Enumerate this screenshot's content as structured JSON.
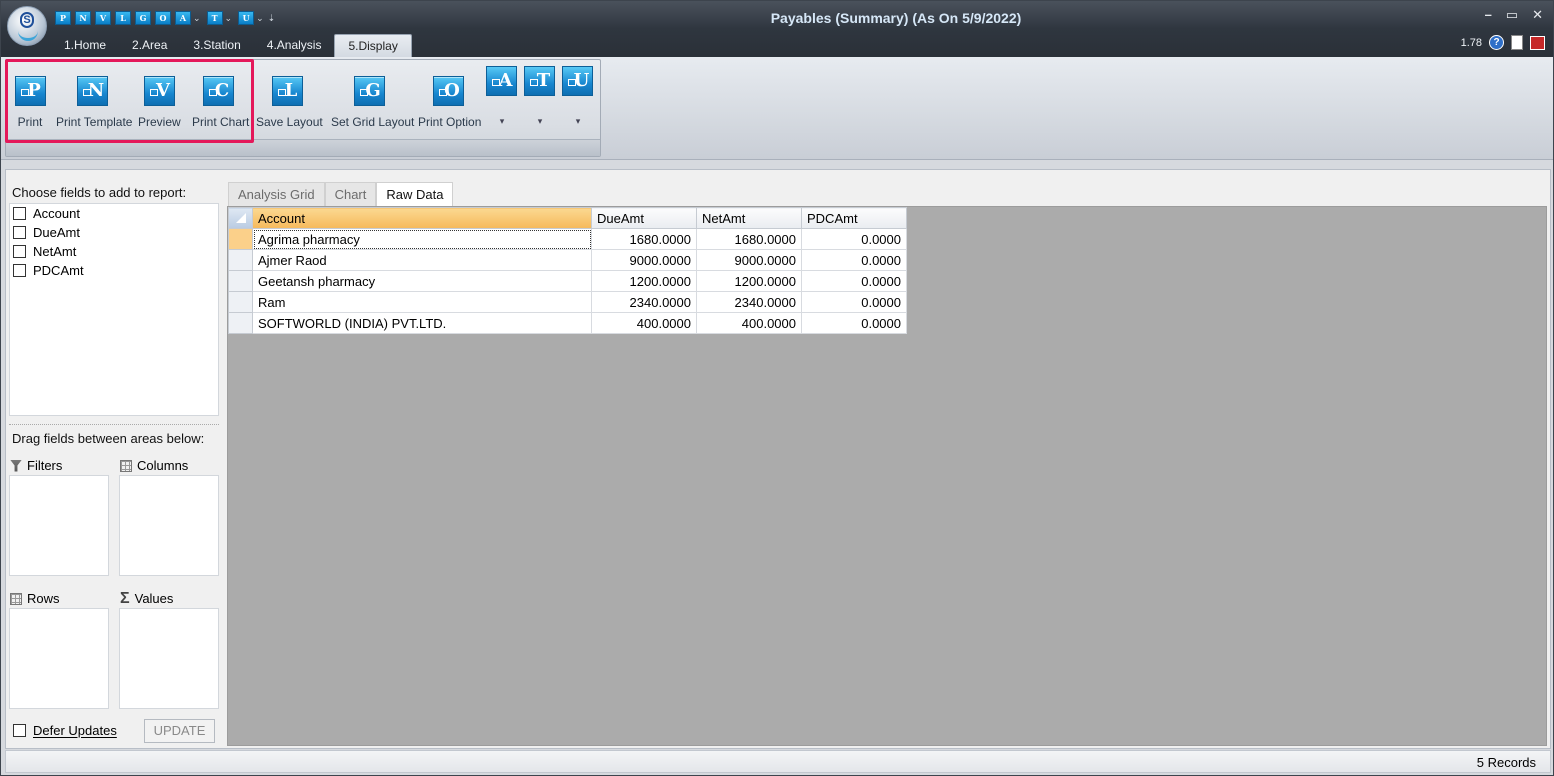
{
  "window": {
    "title": "Payables (Summary) (As On 5/9/2022)",
    "version": "1.78",
    "controls": [
      "–",
      "▭",
      "✕"
    ]
  },
  "qat": {
    "icons": [
      "P",
      "N",
      "V",
      "L",
      "G",
      "O",
      "A",
      "T",
      "U"
    ]
  },
  "tabs": [
    {
      "label": "1.Home",
      "active": false
    },
    {
      "label": "2.Area",
      "active": false
    },
    {
      "label": "3.Station",
      "active": false
    },
    {
      "label": "4.Analysis",
      "active": false
    },
    {
      "label": "5.Display",
      "active": true
    }
  ],
  "ribbon": {
    "buttons": [
      {
        "letter": "P",
        "label": "Print"
      },
      {
        "letter": "N",
        "label": "Print Template"
      },
      {
        "letter": "V",
        "label": "Preview"
      },
      {
        "letter": "C",
        "label": "Print Chart"
      },
      {
        "letter": "L",
        "label": "Save Layout"
      },
      {
        "letter": "G",
        "label": "Set Grid Layout"
      },
      {
        "letter": "O",
        "label": "Print Option"
      }
    ],
    "split_buttons": [
      {
        "letter": "A"
      },
      {
        "letter": "T"
      },
      {
        "letter": "U"
      }
    ]
  },
  "field_list": {
    "title": "Choose fields to add to report:",
    "fields": [
      "Account",
      "DueAmt",
      "NetAmt",
      "PDCAmt"
    ],
    "drag_title": "Drag fields between areas below:",
    "areas": {
      "filters": "Filters",
      "columns": "Columns",
      "rows": "Rows",
      "values": "Values"
    },
    "defer_label": "Defer Updates",
    "update_label": "UPDATE"
  },
  "data_tabs": [
    {
      "label": "Analysis Grid",
      "active": false
    },
    {
      "label": "Chart",
      "active": false
    },
    {
      "label": "Raw Data",
      "active": true
    }
  ],
  "grid": {
    "columns": [
      "Account",
      "DueAmt",
      "NetAmt",
      "PDCAmt"
    ],
    "rows": [
      [
        "Agrima pharmacy",
        "1680.0000",
        "1680.0000",
        "0.0000"
      ],
      [
        "Ajmer Raod",
        "9000.0000",
        "9000.0000",
        "0.0000"
      ],
      [
        "Geetansh pharmacy",
        "1200.0000",
        "1200.0000",
        "0.0000"
      ],
      [
        "Ram",
        "2340.0000",
        "2340.0000",
        "0.0000"
      ],
      [
        "SOFTWORLD (INDIA) PVT.LTD.",
        "400.0000",
        "400.0000",
        "0.0000"
      ]
    ]
  },
  "status": {
    "records": "5 Records"
  }
}
